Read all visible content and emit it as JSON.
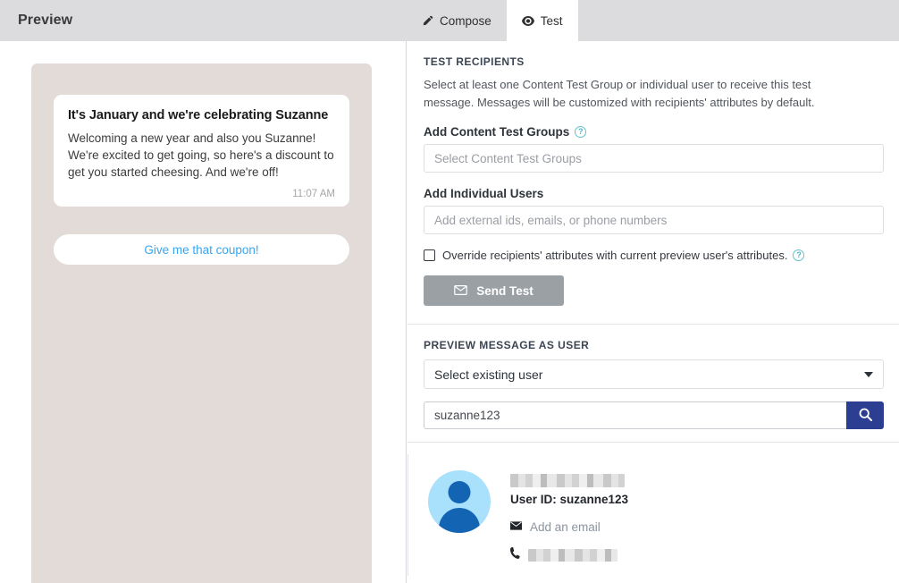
{
  "header": {
    "title": "Preview",
    "tabs": [
      {
        "label": "Compose",
        "icon": "pencil-icon",
        "active": false
      },
      {
        "label": "Test",
        "icon": "eye-icon",
        "active": true
      }
    ]
  },
  "preview": {
    "message": {
      "title": "It's January and we're celebrating Suzanne",
      "body": "Welcoming a new year and also you Suzanne! We're excited to get going, so here's a discount to get you started cheesing. And we're off!",
      "time": "11:07 AM"
    },
    "cta_label": "Give me that coupon!",
    "cta_color": "#3aa5f0",
    "device_bg": "#e2dbd7"
  },
  "test_recipients": {
    "heading": "TEST RECIPIENTS",
    "description": "Select at least one Content Test Group or individual user to receive this test message. Messages will be customized with recipients' attributes by default.",
    "content_test_groups": {
      "label": "Add Content Test Groups",
      "help_icon": "question-circle-icon",
      "placeholder": "Select Content Test Groups",
      "value": ""
    },
    "individual_users": {
      "label": "Add Individual Users",
      "placeholder": "Add external ids, emails, or phone numbers",
      "value": ""
    },
    "override_checkbox": {
      "label": "Override recipients' attributes with current preview user's attributes.",
      "checked": false,
      "help_icon": "question-circle-icon"
    },
    "send_button": {
      "label": "Send Test",
      "icon": "envelope-icon",
      "disabled": true,
      "color": "#9ba0a5"
    }
  },
  "preview_as_user": {
    "heading": "PREVIEW MESSAGE AS USER",
    "select_label": "Select existing user",
    "search": {
      "value": "suzanne123",
      "icon": "search-icon",
      "button_color": "#2c3e92"
    },
    "profile": {
      "name_redacted": true,
      "user_id_label": "User ID: suzanne123",
      "email_link": "Add an email",
      "email_icon": "envelope-icon",
      "phone_icon": "phone-icon",
      "phone_redacted": true,
      "avatar_icon": "user-avatar-icon",
      "avatar_bg": "#a9e0fb",
      "avatar_fg": "#1464b4"
    }
  }
}
